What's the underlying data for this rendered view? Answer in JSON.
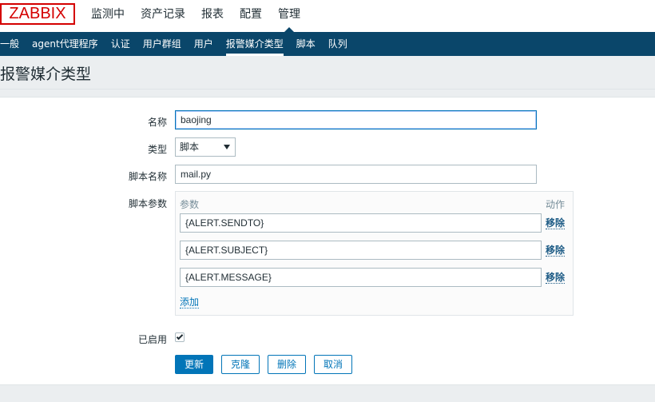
{
  "logo_text": "ZABBIX",
  "main_menu": [
    "监测中",
    "资产记录",
    "报表",
    "配置",
    "管理"
  ],
  "main_menu_active": "管理",
  "sub_menu": [
    "一般",
    "agent代理程序",
    "认证",
    "用户群组",
    "用户",
    "报警媒介类型",
    "脚本",
    "队列"
  ],
  "sub_menu_active": "报警媒介类型",
  "page_title": "报警媒介类型",
  "form": {
    "name_label": "名称",
    "name_value": "baojing",
    "type_label": "类型",
    "type_value": "脚本",
    "script_name_label": "脚本名称",
    "script_name_value": "mail.py",
    "script_params_label": "脚本参数",
    "params_header_param": "参数",
    "params_header_action": "动作",
    "params": [
      {
        "value": "{ALERT.SENDTO}",
        "remove": "移除"
      },
      {
        "value": "{ALERT.SUBJECT}",
        "remove": "移除"
      },
      {
        "value": "{ALERT.MESSAGE}",
        "remove": "移除"
      }
    ],
    "add_label": "添加",
    "enabled_label": "已启用",
    "enabled_checked": true
  },
  "buttons": {
    "update": "更新",
    "clone": "克隆",
    "delete": "删除",
    "cancel": "取消"
  },
  "colors": {
    "brand_red": "#d40000",
    "nav_blue": "#0a466a",
    "primary_blue": "#0275b8"
  }
}
